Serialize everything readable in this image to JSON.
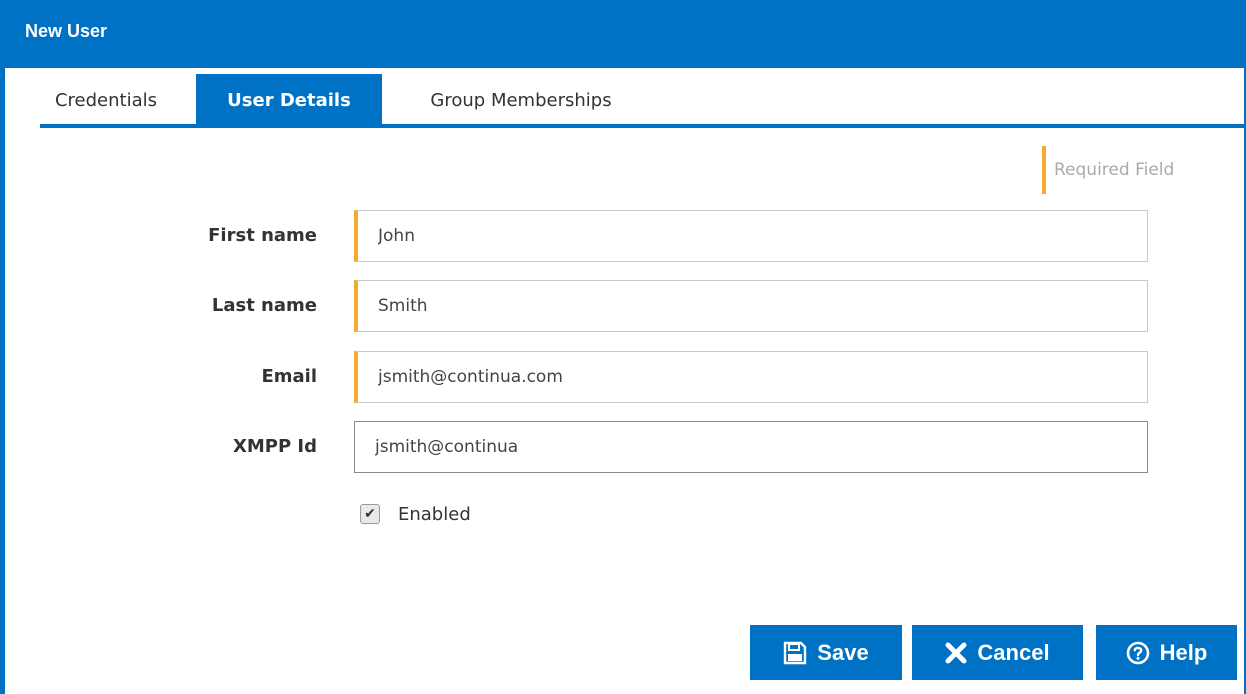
{
  "window": {
    "title": "New User"
  },
  "tabs": [
    {
      "label": "Credentials",
      "active": false
    },
    {
      "label": "User Details",
      "active": true
    },
    {
      "label": "Group Memberships",
      "active": false
    }
  ],
  "legend": {
    "required_label": "Required Field"
  },
  "form": {
    "first_name": {
      "label": "First name",
      "value": "John",
      "required": true
    },
    "last_name": {
      "label": "Last name",
      "value": "Smith",
      "required": true
    },
    "email": {
      "label": "Email",
      "value": "jsmith@continua.com",
      "required": true
    },
    "xmpp_id": {
      "label": "XMPP Id",
      "value": "jsmith@continua",
      "required": false
    },
    "enabled": {
      "label": "Enabled",
      "checked": true
    }
  },
  "buttons": {
    "save": {
      "label": "Save",
      "icon": "save-icon"
    },
    "cancel": {
      "label": "Cancel",
      "icon": "close-icon"
    },
    "help": {
      "label": "Help",
      "icon": "help-icon"
    }
  },
  "colors": {
    "accent": "#0072c6",
    "required_marker": "#f4a92f"
  }
}
